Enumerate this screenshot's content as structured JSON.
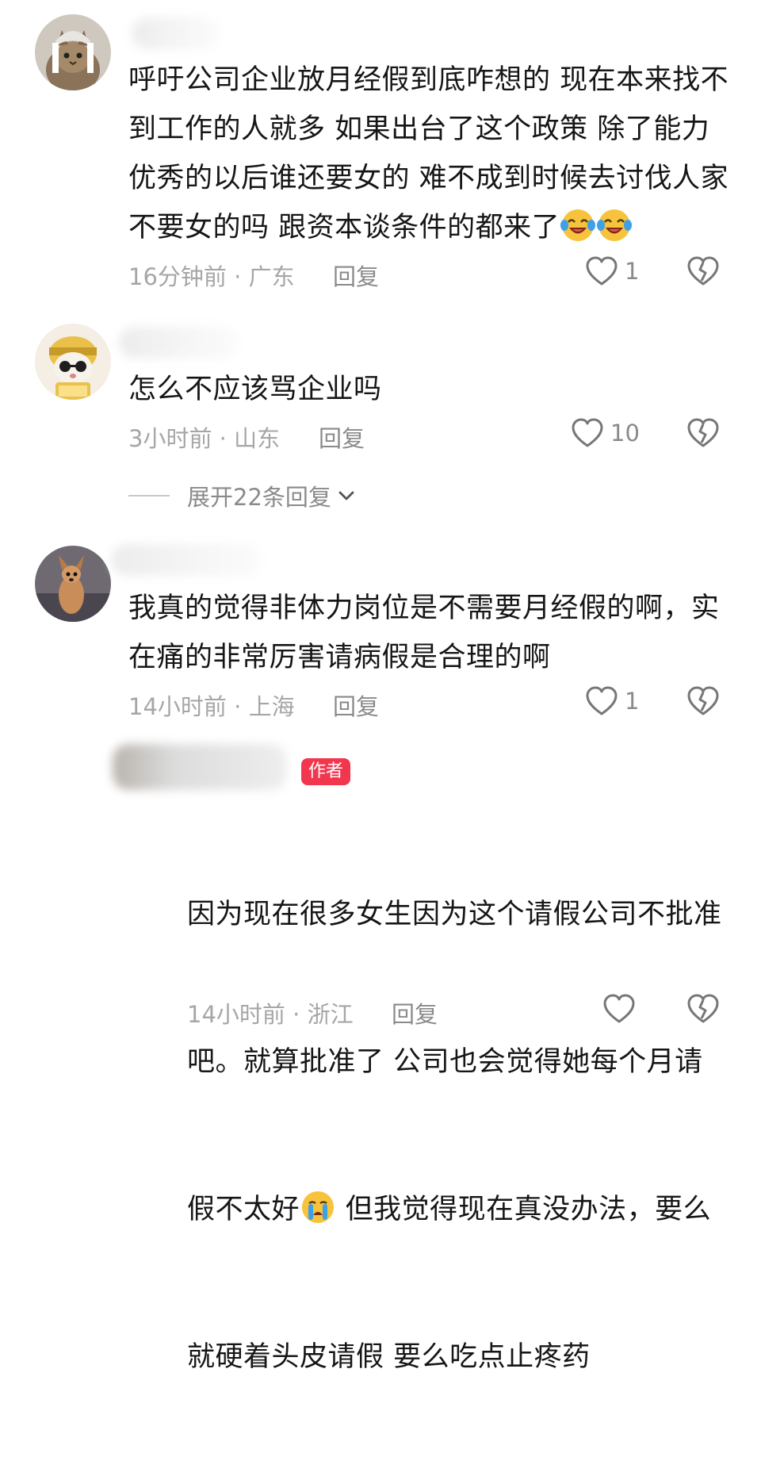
{
  "comments": [
    {
      "text_before_emoji": "呼吁公司企业放月经假到底咋想的 现在本来找不到工作的人就多 如果出台了这个政策 除了能力优秀的以后谁还要女的 难不成到时候去讨伐人家不要女的吗 跟资本谈条件的都来了",
      "emoji": [
        "laugh-cry-emoji",
        "laugh-cry-emoji"
      ],
      "time": "16分钟前",
      "location": "广东",
      "reply_label": "回复",
      "likes": "1"
    },
    {
      "text": "怎么不应该骂企业吗",
      "time": "3小时前",
      "location": "山东",
      "reply_label": "回复",
      "likes": "10",
      "expand_label": "展开22条回复"
    },
    {
      "text": "我真的觉得非体力岗位是不需要月经假的啊，实在痛的非常厉害请病假是合理的啊",
      "time": "14小时前",
      "location": "上海",
      "reply_label": "回复",
      "likes": "1"
    }
  ],
  "reply": {
    "badge": "作者",
    "line1": "因为现在很多女生因为这个请假公司不批准",
    "line2": "吧。就算批准了 公司也会觉得她每个月请",
    "line3_before": "假不太好",
    "line3_after": " 但我觉得现在真没办法，要么",
    "line4": "就硬着头皮请假 要么吃点止疼药",
    "emoji": "crying-emoji",
    "time": "14小时前",
    "location": "浙江",
    "reply_label": "回复",
    "likes": ""
  },
  "meta_separator": " · ",
  "colors": {
    "badge": "#f2364e",
    "meta": "#a6a6a6",
    "text": "#161616"
  }
}
